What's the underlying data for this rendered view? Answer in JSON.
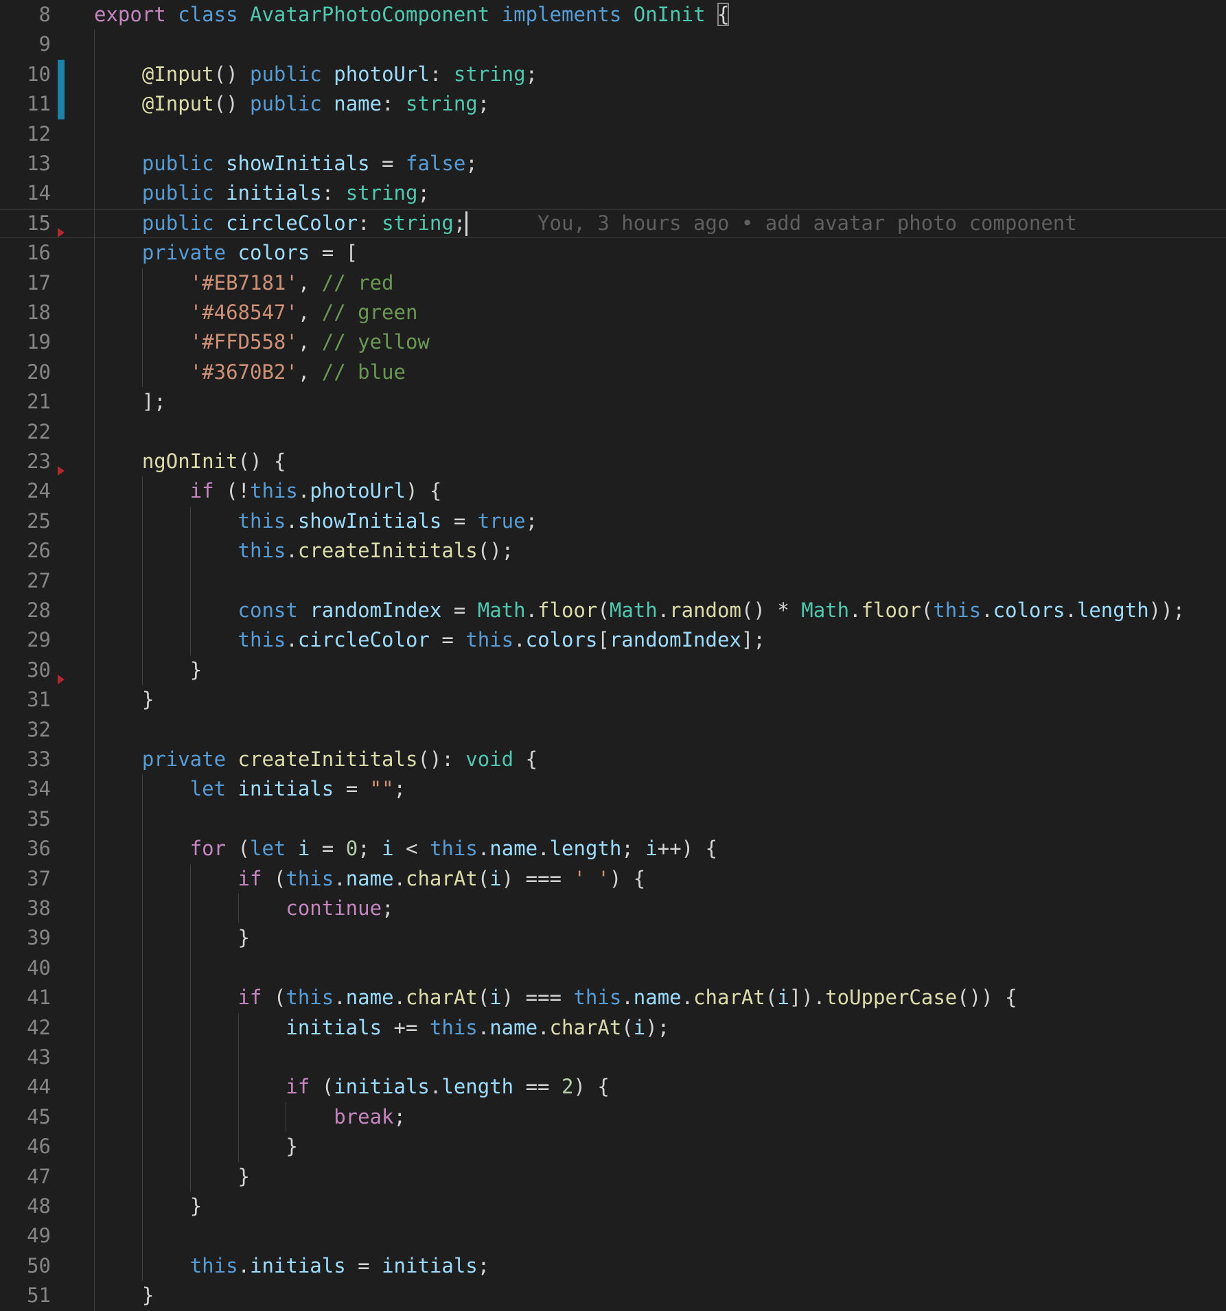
{
  "editor": {
    "language": "typescript",
    "theme_colors": {
      "background": "#1e1e1e",
      "line_number": "#858585",
      "git_modified_bar": "#1b81a8",
      "git_deleted_marker": "#b3282d",
      "control_keyword": "#c586c0",
      "keyword": "#569cd6",
      "type": "#4ec9b0",
      "function": "#dcdcaa",
      "variable": "#9cdcfe",
      "string": "#ce9178",
      "comment": "#6a9955",
      "number": "#b5cea8"
    },
    "current_line": 15,
    "blame": {
      "line": 15,
      "text": "You, 3 hours ago • add avatar photo component"
    },
    "gutter": {
      "modified_lines": [
        10,
        11
      ],
      "deleted_markers_after": [
        15,
        23,
        30
      ]
    },
    "lines": [
      {
        "n": "8",
        "indent": 0,
        "tokens": [
          [
            "ctl",
            "export"
          ],
          [
            "pun",
            " "
          ],
          [
            "kw",
            "class"
          ],
          [
            "pun",
            " "
          ],
          [
            "cls",
            "AvatarPhotoComponent"
          ],
          [
            "pun",
            " "
          ],
          [
            "kw",
            "implements"
          ],
          [
            "pun",
            " "
          ],
          [
            "cls",
            "OnInit"
          ],
          [
            "pun",
            " "
          ],
          [
            "bm",
            "{"
          ]
        ]
      },
      {
        "n": "9",
        "indent": 1,
        "tokens": []
      },
      {
        "n": "10",
        "indent": 1,
        "tokens": [
          [
            "fn",
            "@Input"
          ],
          [
            "pun",
            "() "
          ],
          [
            "kw",
            "public"
          ],
          [
            "pun",
            " "
          ],
          [
            "var",
            "photoUrl"
          ],
          [
            "pun",
            ": "
          ],
          [
            "cls",
            "string"
          ],
          [
            "pun",
            ";"
          ]
        ]
      },
      {
        "n": "11",
        "indent": 1,
        "tokens": [
          [
            "fn",
            "@Input"
          ],
          [
            "pun",
            "() "
          ],
          [
            "kw",
            "public"
          ],
          [
            "pun",
            " "
          ],
          [
            "var",
            "name"
          ],
          [
            "pun",
            ": "
          ],
          [
            "cls",
            "string"
          ],
          [
            "pun",
            ";"
          ]
        ]
      },
      {
        "n": "12",
        "indent": 1,
        "tokens": []
      },
      {
        "n": "13",
        "indent": 1,
        "tokens": [
          [
            "kw",
            "public"
          ],
          [
            "pun",
            " "
          ],
          [
            "var",
            "showInitials"
          ],
          [
            "pun",
            " = "
          ],
          [
            "kw",
            "false"
          ],
          [
            "pun",
            ";"
          ]
        ]
      },
      {
        "n": "14",
        "indent": 1,
        "tokens": [
          [
            "kw",
            "public"
          ],
          [
            "pun",
            " "
          ],
          [
            "var",
            "initials"
          ],
          [
            "pun",
            ": "
          ],
          [
            "cls",
            "string"
          ],
          [
            "pun",
            ";"
          ]
        ]
      },
      {
        "n": "15",
        "indent": 1,
        "tokens": [
          [
            "kw",
            "public"
          ],
          [
            "pun",
            " "
          ],
          [
            "var",
            "circleColor"
          ],
          [
            "pun",
            ": "
          ],
          [
            "cls",
            "string"
          ],
          [
            "pun",
            ";"
          ]
        ],
        "cursor": true,
        "blame": true
      },
      {
        "n": "16",
        "indent": 1,
        "tokens": [
          [
            "kw",
            "private"
          ],
          [
            "pun",
            " "
          ],
          [
            "var",
            "colors"
          ],
          [
            "pun",
            " = ["
          ]
        ]
      },
      {
        "n": "17",
        "indent": 2,
        "tokens": [
          [
            "str",
            "'#EB7181'"
          ],
          [
            "pun",
            ", "
          ],
          [
            "cmt",
            "// red"
          ]
        ]
      },
      {
        "n": "18",
        "indent": 2,
        "tokens": [
          [
            "str",
            "'#468547'"
          ],
          [
            "pun",
            ", "
          ],
          [
            "cmt",
            "// green"
          ]
        ]
      },
      {
        "n": "19",
        "indent": 2,
        "tokens": [
          [
            "str",
            "'#FFD558'"
          ],
          [
            "pun",
            ", "
          ],
          [
            "cmt",
            "// yellow"
          ]
        ]
      },
      {
        "n": "20",
        "indent": 2,
        "tokens": [
          [
            "str",
            "'#3670B2'"
          ],
          [
            "pun",
            ", "
          ],
          [
            "cmt",
            "// blue"
          ]
        ]
      },
      {
        "n": "21",
        "indent": 1,
        "tokens": [
          [
            "pun",
            "];"
          ]
        ]
      },
      {
        "n": "22",
        "indent": 1,
        "tokens": []
      },
      {
        "n": "23",
        "indent": 1,
        "tokens": [
          [
            "fn",
            "ngOnInit"
          ],
          [
            "pun",
            "() {"
          ]
        ]
      },
      {
        "n": "24",
        "indent": 2,
        "tokens": [
          [
            "ctl",
            "if"
          ],
          [
            "pun",
            " (!"
          ],
          [
            "kw",
            "this"
          ],
          [
            "pun",
            "."
          ],
          [
            "var",
            "photoUrl"
          ],
          [
            "pun",
            ") {"
          ]
        ]
      },
      {
        "n": "25",
        "indent": 3,
        "tokens": [
          [
            "kw",
            "this"
          ],
          [
            "pun",
            "."
          ],
          [
            "var",
            "showInitials"
          ],
          [
            "pun",
            " = "
          ],
          [
            "kw",
            "true"
          ],
          [
            "pun",
            ";"
          ]
        ]
      },
      {
        "n": "26",
        "indent": 3,
        "tokens": [
          [
            "kw",
            "this"
          ],
          [
            "pun",
            "."
          ],
          [
            "fn",
            "createInititals"
          ],
          [
            "pun",
            "();"
          ]
        ]
      },
      {
        "n": "27",
        "indent": 3,
        "tokens": []
      },
      {
        "n": "28",
        "indent": 3,
        "tokens": [
          [
            "kw",
            "const"
          ],
          [
            "pun",
            " "
          ],
          [
            "var",
            "randomIndex"
          ],
          [
            "pun",
            " = "
          ],
          [
            "cls",
            "Math"
          ],
          [
            "pun",
            "."
          ],
          [
            "fn",
            "floor"
          ],
          [
            "pun",
            "("
          ],
          [
            "cls",
            "Math"
          ],
          [
            "pun",
            "."
          ],
          [
            "fn",
            "random"
          ],
          [
            "pun",
            "() * "
          ],
          [
            "cls",
            "Math"
          ],
          [
            "pun",
            "."
          ],
          [
            "fn",
            "floor"
          ],
          [
            "pun",
            "("
          ],
          [
            "kw",
            "this"
          ],
          [
            "pun",
            "."
          ],
          [
            "var",
            "colors"
          ],
          [
            "pun",
            "."
          ],
          [
            "var",
            "length"
          ],
          [
            "pun",
            "));"
          ]
        ]
      },
      {
        "n": "29",
        "indent": 3,
        "tokens": [
          [
            "kw",
            "this"
          ],
          [
            "pun",
            "."
          ],
          [
            "var",
            "circleColor"
          ],
          [
            "pun",
            " = "
          ],
          [
            "kw",
            "this"
          ],
          [
            "pun",
            "."
          ],
          [
            "var",
            "colors"
          ],
          [
            "pun",
            "["
          ],
          [
            "var",
            "randomIndex"
          ],
          [
            "pun",
            "];"
          ]
        ]
      },
      {
        "n": "30",
        "indent": 2,
        "tokens": [
          [
            "pun",
            "}"
          ]
        ]
      },
      {
        "n": "31",
        "indent": 1,
        "tokens": [
          [
            "pun",
            "}"
          ]
        ]
      },
      {
        "n": "32",
        "indent": 1,
        "tokens": []
      },
      {
        "n": "33",
        "indent": 1,
        "tokens": [
          [
            "kw",
            "private"
          ],
          [
            "pun",
            " "
          ],
          [
            "fn",
            "createInititals"
          ],
          [
            "pun",
            "(): "
          ],
          [
            "cls",
            "void"
          ],
          [
            "pun",
            " {"
          ]
        ]
      },
      {
        "n": "34",
        "indent": 2,
        "tokens": [
          [
            "kw",
            "let"
          ],
          [
            "pun",
            " "
          ],
          [
            "var",
            "initials"
          ],
          [
            "pun",
            " = "
          ],
          [
            "str",
            "\"\""
          ],
          [
            "pun",
            ";"
          ]
        ]
      },
      {
        "n": "35",
        "indent": 2,
        "tokens": []
      },
      {
        "n": "36",
        "indent": 2,
        "tokens": [
          [
            "ctl",
            "for"
          ],
          [
            "pun",
            " ("
          ],
          [
            "kw",
            "let"
          ],
          [
            "pun",
            " "
          ],
          [
            "var",
            "i"
          ],
          [
            "pun",
            " = "
          ],
          [
            "num",
            "0"
          ],
          [
            "pun",
            "; "
          ],
          [
            "var",
            "i"
          ],
          [
            "pun",
            " < "
          ],
          [
            "kw",
            "this"
          ],
          [
            "pun",
            "."
          ],
          [
            "var",
            "name"
          ],
          [
            "pun",
            "."
          ],
          [
            "var",
            "length"
          ],
          [
            "pun",
            "; "
          ],
          [
            "var",
            "i"
          ],
          [
            "pun",
            "++) {"
          ]
        ]
      },
      {
        "n": "37",
        "indent": 3,
        "tokens": [
          [
            "ctl",
            "if"
          ],
          [
            "pun",
            " ("
          ],
          [
            "kw",
            "this"
          ],
          [
            "pun",
            "."
          ],
          [
            "var",
            "name"
          ],
          [
            "pun",
            "."
          ],
          [
            "fn",
            "charAt"
          ],
          [
            "pun",
            "("
          ],
          [
            "var",
            "i"
          ],
          [
            "pun",
            ") === "
          ],
          [
            "str",
            "' '"
          ],
          [
            "pun",
            ") {"
          ]
        ]
      },
      {
        "n": "38",
        "indent": 4,
        "tokens": [
          [
            "ctl",
            "continue"
          ],
          [
            "pun",
            ";"
          ]
        ]
      },
      {
        "n": "39",
        "indent": 3,
        "tokens": [
          [
            "pun",
            "}"
          ]
        ]
      },
      {
        "n": "40",
        "indent": 3,
        "tokens": []
      },
      {
        "n": "41",
        "indent": 3,
        "tokens": [
          [
            "ctl",
            "if"
          ],
          [
            "pun",
            " ("
          ],
          [
            "kw",
            "this"
          ],
          [
            "pun",
            "."
          ],
          [
            "var",
            "name"
          ],
          [
            "pun",
            "."
          ],
          [
            "fn",
            "charAt"
          ],
          [
            "pun",
            "("
          ],
          [
            "var",
            "i"
          ],
          [
            "pun",
            ") === "
          ],
          [
            "kw",
            "this"
          ],
          [
            "pun",
            "."
          ],
          [
            "var",
            "name"
          ],
          [
            "pun",
            "."
          ],
          [
            "fn",
            "charAt"
          ],
          [
            "pun",
            "("
          ],
          [
            "var",
            "i"
          ],
          [
            "pun",
            "])."
          ],
          [
            "fn",
            "toUpperCase"
          ],
          [
            "pun",
            "()) {"
          ]
        ]
      },
      {
        "n": "42",
        "indent": 4,
        "tokens": [
          [
            "var",
            "initials"
          ],
          [
            "pun",
            " += "
          ],
          [
            "kw",
            "this"
          ],
          [
            "pun",
            "."
          ],
          [
            "var",
            "name"
          ],
          [
            "pun",
            "."
          ],
          [
            "fn",
            "charAt"
          ],
          [
            "pun",
            "("
          ],
          [
            "var",
            "i"
          ],
          [
            "pun",
            ");"
          ]
        ]
      },
      {
        "n": "43",
        "indent": 4,
        "tokens": []
      },
      {
        "n": "44",
        "indent": 4,
        "tokens": [
          [
            "ctl",
            "if"
          ],
          [
            "pun",
            " ("
          ],
          [
            "var",
            "initials"
          ],
          [
            "pun",
            "."
          ],
          [
            "var",
            "length"
          ],
          [
            "pun",
            " == "
          ],
          [
            "num",
            "2"
          ],
          [
            "pun",
            ") {"
          ]
        ]
      },
      {
        "n": "45",
        "indent": 5,
        "tokens": [
          [
            "ctl",
            "break"
          ],
          [
            "pun",
            ";"
          ]
        ]
      },
      {
        "n": "46",
        "indent": 4,
        "tokens": [
          [
            "pun",
            "}"
          ]
        ]
      },
      {
        "n": "47",
        "indent": 3,
        "tokens": [
          [
            "pun",
            "}"
          ]
        ]
      },
      {
        "n": "48",
        "indent": 2,
        "tokens": [
          [
            "pun",
            "}"
          ]
        ]
      },
      {
        "n": "49",
        "indent": 2,
        "tokens": []
      },
      {
        "n": "50",
        "indent": 2,
        "tokens": [
          [
            "kw",
            "this"
          ],
          [
            "pun",
            "."
          ],
          [
            "var",
            "initials"
          ],
          [
            "pun",
            " = "
          ],
          [
            "var",
            "initials"
          ],
          [
            "pun",
            ";"
          ]
        ]
      },
      {
        "n": "51",
        "indent": 1,
        "tokens": [
          [
            "pun",
            "}"
          ]
        ]
      }
    ]
  }
}
